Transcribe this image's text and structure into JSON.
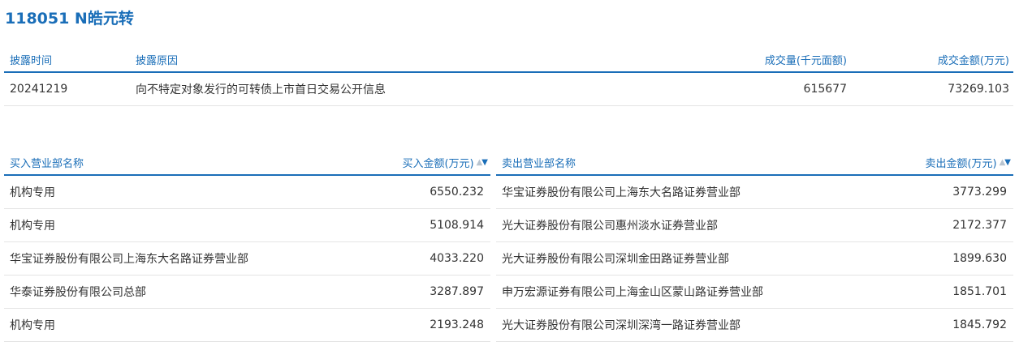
{
  "title": "118051 N皓元转",
  "disclosure": {
    "headers": {
      "date": "披露时间",
      "reason": "披露原因",
      "volume": "成交量(千元面额)",
      "amount": "成交金额(万元)"
    },
    "rows": [
      {
        "date": "20241219",
        "reason": "向不特定对象发行的可转债上市首日交易公开信息",
        "volume": "615677",
        "amount": "73269.103"
      }
    ]
  },
  "buy": {
    "headers": {
      "name": "买入营业部名称",
      "amount": "买入金额(万元)"
    },
    "sort_up": "▲",
    "sort_down": "▼",
    "rows": [
      {
        "name": "机构专用",
        "amount": "6550.232"
      },
      {
        "name": "机构专用",
        "amount": "5108.914"
      },
      {
        "name": "华宝证券股份有限公司上海东大名路证券营业部",
        "amount": "4033.220"
      },
      {
        "name": "华泰证券股份有限公司总部",
        "amount": "3287.897"
      },
      {
        "name": "机构专用",
        "amount": "2193.248"
      }
    ]
  },
  "sell": {
    "headers": {
      "name": "卖出营业部名称",
      "amount": "卖出金额(万元)"
    },
    "sort_up": "▲",
    "sort_down": "▼",
    "rows": [
      {
        "name": "华宝证券股份有限公司上海东大名路证券营业部",
        "amount": "3773.299"
      },
      {
        "name": "光大证券股份有限公司惠州淡水证券营业部",
        "amount": "2172.377"
      },
      {
        "name": "光大证券股份有限公司深圳金田路证券营业部",
        "amount": "1899.630"
      },
      {
        "name": "申万宏源证券有限公司上海金山区蒙山路证券营业部",
        "amount": "1851.701"
      },
      {
        "name": "光大证券股份有限公司深圳深湾一路证券营业部",
        "amount": "1845.792"
      }
    ]
  },
  "colors": {
    "accent": "#1a6eb8",
    "divider": "#e4e4e4",
    "text": "#333333"
  }
}
